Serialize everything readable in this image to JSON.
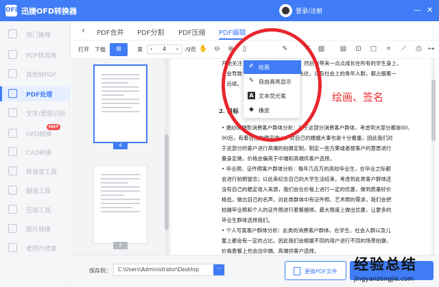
{
  "app": {
    "title": "迅捷OFD转换器",
    "logo": "OFD",
    "login": "登录/注册"
  },
  "window_controls": [
    "—",
    "✕"
  ],
  "sidebar": {
    "items": [
      {
        "label": "热门推荐",
        "active": false,
        "hot": false
      },
      {
        "label": "PDF转其他",
        "active": false,
        "hot": false
      },
      {
        "label": "其他转PDF",
        "active": false,
        "hot": false
      },
      {
        "label": "PDF处理",
        "active": true,
        "hot": false
      },
      {
        "label": "文字/票据识别",
        "active": false,
        "hot": false
      },
      {
        "label": "OFD转换",
        "active": false,
        "hot": true
      },
      {
        "label": "CAD转换",
        "active": false,
        "hot": false
      },
      {
        "label": "转语音工具",
        "active": false,
        "hot": false
      },
      {
        "label": "翻译工具",
        "active": false,
        "hot": false
      },
      {
        "label": "压缩工具",
        "active": false,
        "hot": false
      },
      {
        "label": "图片转换",
        "active": false,
        "hot": false
      },
      {
        "label": "老照片修复",
        "active": false,
        "hot": false
      }
    ],
    "hot_badge": "HOT"
  },
  "tabs": {
    "back": "‹",
    "items": [
      "PDF合并",
      "PDF分割",
      "PDF压缩",
      "PDF编辑"
    ],
    "active": 3
  },
  "toolbar": {
    "open": "打开",
    "download": "下载",
    "grid": "⊞",
    "page_prefix": "第",
    "page_current": "4",
    "page_total": "/9页",
    "icons": [
      "hand-icon",
      "zoom-out-icon",
      "zoom-in-icon",
      "page-icon",
      "draw-icon",
      "text-icon",
      "image-icon",
      "note-icon",
      "stamp-icon",
      "shape-icon",
      "crop-icon",
      "line-icon",
      "print-icon",
      "link-icon",
      "more-icon"
    ]
  },
  "thumbnails": [
    {
      "page": "4",
      "selected": true
    },
    {
      "page": "5",
      "selected": false
    }
  ],
  "document": {
    "lines_top": [
      "开始关注，女，也有正当的男士在，然后也带来一点点成长在所有的学生身上，",
      "，会导致宽松的地方，也有更新的去往，以及社会上的青年人群，都占据着一",
      "，后续。"
    ],
    "heading": "2. 目标",
    "lines_body": [
      "• 婚纱照摄影消费客户群体分析：对于这部分消费客户群体，考虑到大部分都是80、",
      "90后，有着自己的稳定收入，对自己的婚姻大事也是十分看重，因此我们对",
      "于这部分的客户进行高端的拍摄定制，制定一些方案或者按客户的意愿进行",
      "量身定做，价格会偏高于中端和高端供客户选择。",
      "• 毕业照、证件照客户群体分析：每年几百万的高校毕业生，在毕业之际都",
      "会进行拍照留念；以此来纪念自己的大学生活结束。考虑到此类客户群体还",
      "没有自己的稳定收入来源，我们会在价格上进行一定的优惠，做到质量好价",
      "格低，做出自己的名声。对此类群体中有证件照、艺术照的需求，我们会把",
      "拍摄毕业照和个人的证件照进行套餐捆绑，最大限度上做出优惠，让更多的",
      "毕业生群体选择我们。",
      "• 个人写真客户群体分析：此类的消费客户群体，在学生、社会人群以及儿",
      "童上都会有一定的占比，因此我们会根据不同的用户进行不同的场景拍摄，",
      "价格套餐上也会出中端、高端供客户选择。"
    ]
  },
  "dropdown": {
    "items": [
      {
        "label": "绘画",
        "icon": "pen-icon",
        "active": true
      },
      {
        "label": "自由高亮显示",
        "icon": "highlighter-icon",
        "active": false
      },
      {
        "label": "文本荧光笔",
        "icon": "text-highlight-icon",
        "active": false
      },
      {
        "label": "橡皮",
        "icon": "eraser-icon",
        "active": false
      }
    ]
  },
  "annotation": {
    "text": "绘画、签名",
    "color": "#e8262d"
  },
  "bottom": {
    "save_to": "保存到：",
    "path": "C:\\Users\\Administrator\\Desktop",
    "browse": "···",
    "change_button": "更换PDF文件"
  },
  "watermark": {
    "main": "经验总结",
    "sub": "jingyanzongjie.com"
  },
  "colors": {
    "accent": "#3f7cf5",
    "annotation": "#e8262d"
  }
}
